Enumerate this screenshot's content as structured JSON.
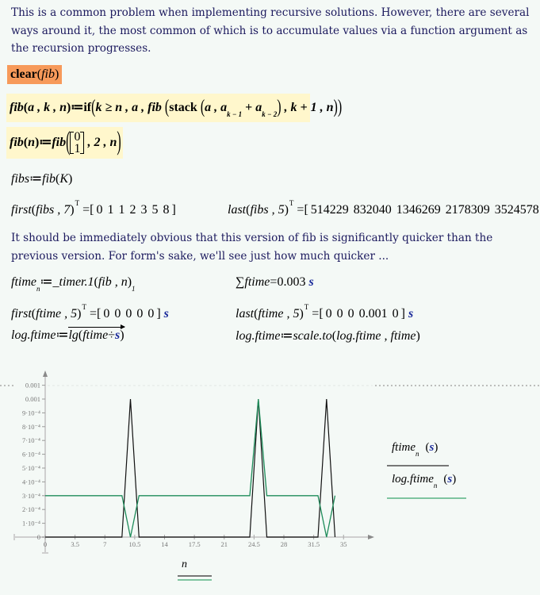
{
  "page": {
    "background": "#f4f9f6",
    "text_color": "#1c1a5e",
    "unit_color": "#1a2a9a"
  },
  "symbols": {
    "lparen": "(",
    "rparen": ")",
    "lbracket": "[",
    "rbracket": "]",
    "assign": "≔",
    "equals": "=",
    "transpose": "T",
    "sum": "∑",
    "divide": "÷"
  },
  "paragraph_1": {
    "lines": [
      "This is a common problem when implementing recursive solutions.  However, there are several",
      "ways around it, the most common of which is to accumulate values via a function argument as",
      "the recursion progresses."
    ]
  },
  "clear_region": {
    "function": "clear",
    "argument": "fib",
    "highlight": "#f79a5a"
  },
  "fib_accumulator_def": {
    "name": "fib",
    "params": "a , k , n",
    "if_keyword": "if",
    "condition": "k ≥ n , a , ",
    "recursive_call": "fib",
    "stack_keyword": "stack",
    "stack_first": "a , ",
    "term": "a",
    "term_sub_1": "k − 1",
    "plus": " + ",
    "term_sub_2": "k − 2",
    "next_args": " , k + 1 , n",
    "highlight": "#fff7cc"
  },
  "fib_wrapper_def": {
    "name": "fib",
    "param": "n",
    "call": "fib",
    "initial_vector": [
      "0",
      "1"
    ],
    "rest_args": " , 2 , n"
  },
  "fibs_def": {
    "lhs": "fibs",
    "call": "fib",
    "arg": "K"
  },
  "first_fibs": {
    "call": "first",
    "args": "fibs , 7",
    "values": [
      "0",
      "1",
      "1",
      "2",
      "3",
      "5",
      "8"
    ]
  },
  "last_fibs": {
    "call": "last",
    "args": "fibs , 5",
    "values": [
      "514229",
      "832040",
      "1346269",
      "2178309",
      "3524578"
    ]
  },
  "paragraph_2": {
    "lines": [
      "It should be immediately obvious that this version of fib is significantly quicker than the",
      "previous version.   For form's sake, we'll see just how much quicker ..."
    ]
  },
  "ftime_def": {
    "lhs": "ftime",
    "lhs_sub": "n",
    "call": "_timer.1",
    "args": "fib , n",
    "result_sub": "1"
  },
  "sum_ftime": {
    "var": "ftime",
    "value": "0.003",
    "unit": "s"
  },
  "first_ftime": {
    "call": "first",
    "args": "ftime , 5",
    "values": [
      "0",
      "0",
      "0",
      "0",
      "0"
    ],
    "unit": "s"
  },
  "last_ftime": {
    "call": "last",
    "args": "ftime , 5",
    "values": [
      "0",
      "0",
      "0",
      "0.001",
      "0"
    ],
    "unit": "s"
  },
  "log_ftime_def": {
    "lhs": "log.ftime",
    "func": "lg",
    "numerator": "ftime",
    "unit": "s"
  },
  "log_ftime_scale": {
    "lhs": "log.ftime",
    "call": "scale.to",
    "args": "log.ftime , ftime"
  },
  "chart_data": {
    "type": "line",
    "title": "",
    "xlabel": "n",
    "ylabel": "",
    "xlim": [
      0,
      35
    ],
    "ylim": [
      0,
      0.0011
    ],
    "grid": false,
    "legend_placement": "right",
    "x_ticks": [
      {
        "value": 0,
        "label": "0"
      },
      {
        "value": 3.5,
        "label": "3.5"
      },
      {
        "value": 7,
        "label": "7"
      },
      {
        "value": 10.5,
        "label": "10.5"
      },
      {
        "value": 14,
        "label": "14"
      },
      {
        "value": 17.5,
        "label": "17.5"
      },
      {
        "value": 21,
        "label": "21"
      },
      {
        "value": 24.5,
        "label": "24.5"
      },
      {
        "value": 28,
        "label": "28"
      },
      {
        "value": 31.5,
        "label": "31.5"
      },
      {
        "value": 35,
        "label": "35"
      }
    ],
    "y_ticks": [
      {
        "value": 0,
        "label": "0"
      },
      {
        "value": 0.0001,
        "label": "1·10⁻⁴"
      },
      {
        "value": 0.0002,
        "label": "2·10⁻⁴"
      },
      {
        "value": 0.0003,
        "label": "3·10⁻⁴"
      },
      {
        "value": 0.0004,
        "label": "4·10⁻⁴"
      },
      {
        "value": 0.0005,
        "label": "5·10⁻⁴"
      },
      {
        "value": 0.0006,
        "label": "6·10⁻⁴"
      },
      {
        "value": 0.0007,
        "label": "7·10⁻⁴"
      },
      {
        "value": 0.0008,
        "label": "8·10⁻⁴"
      },
      {
        "value": 0.0009,
        "label": "9·10⁻⁴"
      },
      {
        "value": 0.001,
        "label": "0.001"
      },
      {
        "value": 0.0011,
        "label": "0.001"
      }
    ],
    "x": [
      0,
      1,
      2,
      3,
      4,
      5,
      6,
      7,
      8,
      9,
      10,
      11,
      12,
      13,
      14,
      15,
      16,
      17,
      18,
      19,
      20,
      21,
      22,
      23,
      24,
      25,
      26,
      27,
      28,
      29,
      30,
      31,
      32,
      33,
      34
    ],
    "series": [
      {
        "name": "ftime",
        "legend_label": "ftime",
        "legend_sub": "n",
        "legend_unit": "s",
        "color": "#111111",
        "legend_color": "#777777",
        "values": [
          0,
          0,
          0,
          0,
          0,
          0,
          0,
          0,
          0,
          0,
          0.001,
          0,
          0,
          0,
          0,
          0,
          0,
          0,
          0,
          0,
          0,
          0,
          0,
          0,
          0,
          0.001,
          0,
          0,
          0,
          0,
          0,
          0,
          0,
          0.001,
          0
        ]
      },
      {
        "name": "log.ftime",
        "legend_label": "log.ftime",
        "legend_sub": "n",
        "legend_unit": "s",
        "color": "#1e8c5a",
        "legend_color": "#7fc4a0",
        "values": [
          0.0003,
          0.0003,
          0.0003,
          0.0003,
          0.0003,
          0.0003,
          0.0003,
          0.0003,
          0.0003,
          0.0003,
          0,
          0.0003,
          0.0003,
          0.0003,
          0.0003,
          0.0003,
          0.0003,
          0.0003,
          0.0003,
          0.0003,
          0.0003,
          0.0003,
          0.0003,
          0.0003,
          0.0003,
          0.001,
          0.0003,
          0.0003,
          0.0003,
          0.0003,
          0.0003,
          0.0003,
          0.0003,
          0,
          0.0003
        ]
      }
    ]
  }
}
